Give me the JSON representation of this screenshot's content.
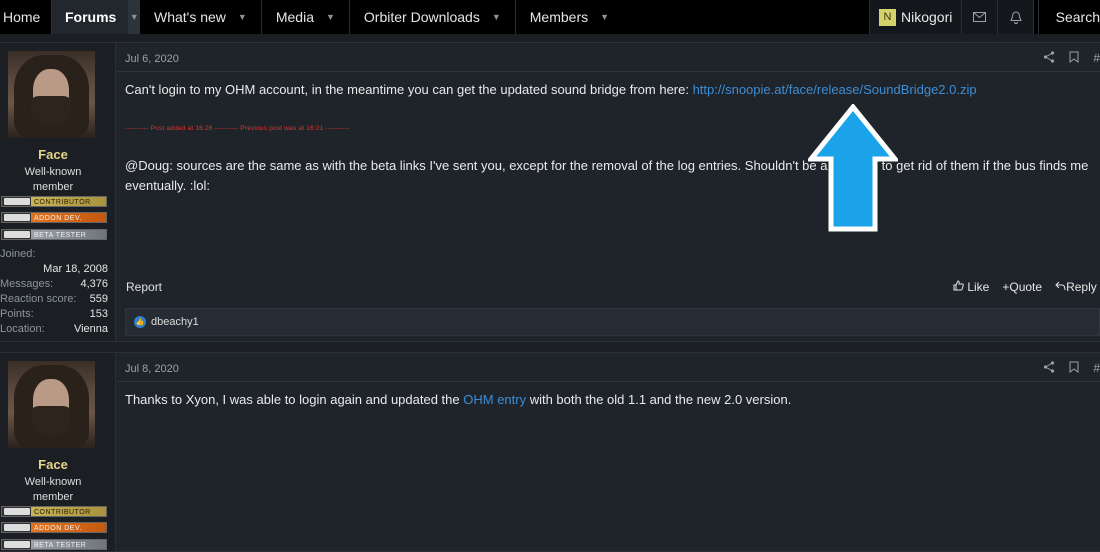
{
  "nav": {
    "home": "Home",
    "forums": "Forums",
    "whats_new": "What's new",
    "media": "Media",
    "orbiter_downloads": "Orbiter Downloads",
    "members": "Members",
    "user_initial": "N",
    "username": "Nikogori",
    "search": "Search"
  },
  "posts": [
    {
      "date": "Jul 6, 2020",
      "author": "Face",
      "title": "Well-known member",
      "banners": [
        "Contributor",
        "Addon Dev.",
        "Beta Tester"
      ],
      "stats": {
        "joined_label": "Joined:",
        "joined": "Mar 18, 2008",
        "messages_label": "Messages:",
        "messages": "4,376",
        "reaction_label": "Reaction score:",
        "reaction": "559",
        "points_label": "Points:",
        "points": "153",
        "location_label": "Location:",
        "location": "Vienna"
      },
      "text1": "Can't login to my OHM account, in the meantime you can get the updated sound bridge from here: ",
      "link1": "http://snoopie.at/face/release/SoundBridge2.0.zip",
      "merge_note": "---------- Post added at 16:26 ---------- Previous post was at 16:21 ----------",
      "text2": "@Doug: sources are the same as with the beta links I've sent you, except for the removal of the log entries. Shouldn't be a problem to get rid of them if the bus finds me eventually. :lol:",
      "report": "Report",
      "like": "Like",
      "quote": "Quote",
      "reply": "Reply",
      "reaction_user": "dbeachy1"
    },
    {
      "date": "Jul 8, 2020",
      "author": "Face",
      "title": "Well-known member",
      "banners": [
        "Contributor",
        "Addon Dev.",
        "Beta Tester"
      ],
      "text_before": "Thanks to Xyon, I was able to login again and updated the ",
      "link": "OHM entry",
      "text_after": " with both the old 1.1 and the new 2.0 version."
    }
  ],
  "colors": {
    "accent_link": "#3d8dd6",
    "author": "#e4d58a",
    "arrow": "#1aa3e8"
  }
}
